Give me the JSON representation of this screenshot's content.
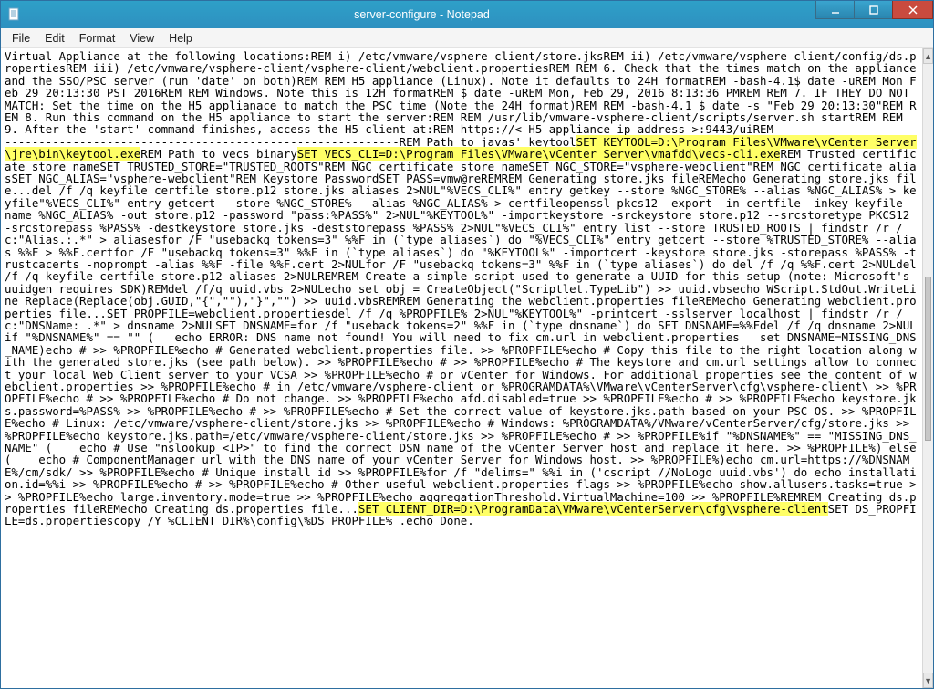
{
  "window": {
    "title": "server-configure - Notepad"
  },
  "menubar": {
    "file": "File",
    "edit": "Edit",
    "format": "Format",
    "view": "View",
    "help": "Help"
  },
  "highlights": {
    "h1": "SET KEYTOOL=D:\\Program Files\\VMware\\vCenter Server\\jre\\bin\\keytool.exe",
    "h2": "SET VECS_CLI=D:\\Program Files\\VMware\\vCenter Server\\vmafdd\\vecs-cli.exe",
    "h3": "SET CLIENT_DIR=D:\\ProgramData\\VMware\\vCenterServer\\cfg\\vsphere-client"
  },
  "text": {
    "p1": "Virtual Appliance at the following locations:REM i) /etc/vmware/vsphere-client/store.jksREM ii) /etc/vmware/vsphere-client/config/ds.propertiesREM iii) /etc/vmware/vsphere-client/vsphere-client/webclient.propertiesREM REM 6. Check that the times match on the appliance and the SSO/PSC server (run 'date' on both)REM REM H5 appliance (Linux). Note it defaults to 24H formatREM -bash-4.1$ date -uREM Mon Feb 29 20:13:30 PST 2016REM REM Windows. Note this is 12H formatREM $ date -uREM Mon, Feb 29, 2016 8:13:36 PMREM REM 7. IF THEY DO NOT MATCH: Set the time on the H5 applianace to match the PSC time (Note the 24H format)REM REM -bash-4.1 $ date -s \"Feb 29 20:13:30\"REM REM 8. Run this command on the H5 appliance to start the server:REM REM /usr/lib/vmware-vsphere-client/scripts/server.sh startREM REM 9. After the 'start' command finishes, access the H5 client at:REM https://< H5 appliance ip-address >:9443/uiREM ------------------------------------------------------------------------------REM Path to javas' keytool",
    "p2": "REM Path to vecs binary",
    "p3": "REM Trusted certificate store nameSET TRUSTED_STORE=\"TRUSTED_ROOTS\"REM NGC certificate store nameSET NGC_STORE=\"vsphere-webclient\"REM NGC certificate aliasSET NGC_ALIAS=\"vsphere-webclient\"REM Keystore PasswordSET PASS=vmw@reREMREM Generating store.jks fileREMecho Generating store.jks file...del /f /q keyfile certfile store.p12 store.jks aliases 2>NUL\"%VECS_CLI%\" entry getkey --store %NGC_STORE% --alias %NGC_ALIAS% > keyfile\"%VECS_CLI%\" entry getcert --store %NGC_STORE% --alias %NGC_ALIAS% > certfileopenssl pkcs12 -export -in certfile -inkey keyfile -name %NGC_ALIAS% -out store.p12 -password \"pass:%PASS%\" 2>NUL\"%KEYTOOL%\" -importkeystore -srckeystore store.p12 --srcstoretype PKCS12 -srcstorepass %PASS% -destkeystore store.jks -deststorepass %PASS% 2>NUL\"%VECS_CLI%\" entry list --store TRUSTED_ROOTS | findstr /r /c:\"Alias.:.*\" > aliasesfor /F \"usebackq tokens=3\" %%F in (`type aliases`) do \"%VECS_CLI%\" entry getcert --store %TRUSTED_STORE% --alias %%F > %%F.certfor /F \"usebackq tokens=3\" %%F in (`type aliases`) do \"%KEYTOOL%\" -importcert -keystore store.jks -storepass %PASS% -trustcacerts -noprompt -alias %%F -file %%F.cert 2>NULfor /F \"usebackq tokens=3\" %%F in (`type aliases`) do del /f /q %%F.cert 2>NULdel /f /q keyfile certfile store.p12 aliases 2>NULREMREM Create a simple script used to generate a UUID for this setup (note: Microsoft's uuidgen requires SDK)REMdel /f/q uuid.vbs 2>NULecho set obj = CreateObject(\"Scriptlet.TypeLib\") >> uuid.vbsecho WScript.StdOut.WriteLine Replace(Replace(obj.GUID,\"{\",\"\"),\"}\",\"\") >> uuid.vbsREMREM Generating the webclient.properties fileREMecho Generating webclient.properties file...SET PROPFILE=webclient.propertiesdel /f /q %PROPFILE% 2>NUL\"%KEYTOOL%\" -printcert -sslserver localhost | findstr /r /c:\"DNSName: .*\" > dnsname 2>NULSET DNSNAME=for /f \"useback tokens=2\" %%F in (`type dnsname`) do SET DNSNAME=%%Fdel /f /q dnsname 2>NULif \"%DNSNAME%\" == \"\" (   echo ERROR: DNS name not found! You will need to fix cm.url in webclient.properties   set DNSNAME=MISSING_DNS_NAME)echo # >> %PROPFILE%echo # Generated webclient.properties file. >> %PROPFILE%echo # Copy this file to the right location along with the generated store.jks (see path below). >> %PROPFILE%echo # >> %PROPFILE%echo # The keystore and cm.url settings allow to connect your local Web Client server to your VCSA >> %PROPFILE%echo # or vCenter for Windows. For additional properties see the content of webclient.properties >> %PROPFILE%echo # in /etc/vmware/vsphere-client or %PROGRAMDATA%\\VMware\\vCenterServer\\cfg\\vsphere-client\\ >> %PROPFILE%echo # >> %PROPFILE%echo # Do not change. >> %PROPFILE%echo afd.disabled=true >> %PROPFILE%echo # >> %PROPFILE%echo keystore.jks.password=%PASS% >> %PROPFILE%echo # >> %PROPFILE%echo # Set the correct value of keystore.jks.path based on your PSC OS. >> %PROPFILE%echo # Linux: /etc/vmware/vsphere-client/store.jks >> %PROPFILE%echo # Windows: %PROGRAMDATA%/VMware/vCenterServer/cfg/store.jks >> %PROPFILE%echo keystore.jks.path=/etc/vmware/vsphere-client/store.jks >> %PROPFILE%echo # >> %PROPFILE%if \"%DNSNAME%\" == \"MISSING_DNS_NAME\" (    echo # Use \"nslookup <IP>\" to find the correct DSN name of the vCenter Server host and replace it here. >> %PROPFILE%) else (    echo # ComponentManager url with the DNS name of your vCenter Server for Windows host. >> %PROPFILE%)echo cm.url=https://%DNSNAME%/cm/sdk/ >> %PROPFILE%echo # Unique install id >> %PROPFILE%for /f \"delims=\" %%i in ('cscript //NoLogo uuid.vbs') do echo installation.id=%%i >> %PROPFILE%echo # >> %PROPFILE%echo # Other useful webclient.properties flags >> %PROPFILE%echo show.allusers.tasks=true >> %PROPFILE%echo large.inventory.mode=true >> %PROPFILE%echo aggregationThreshold.VirtualMachine=100 >> %PROPFILE%REMREM Creating ds.properties fileREMecho Creating ds.properties file...",
    "p4": "SET DS_PROPFILE=ds.propertiescopy /Y %CLIENT_DIR%\\config\\%DS_PROPFILE% .echo Done."
  }
}
